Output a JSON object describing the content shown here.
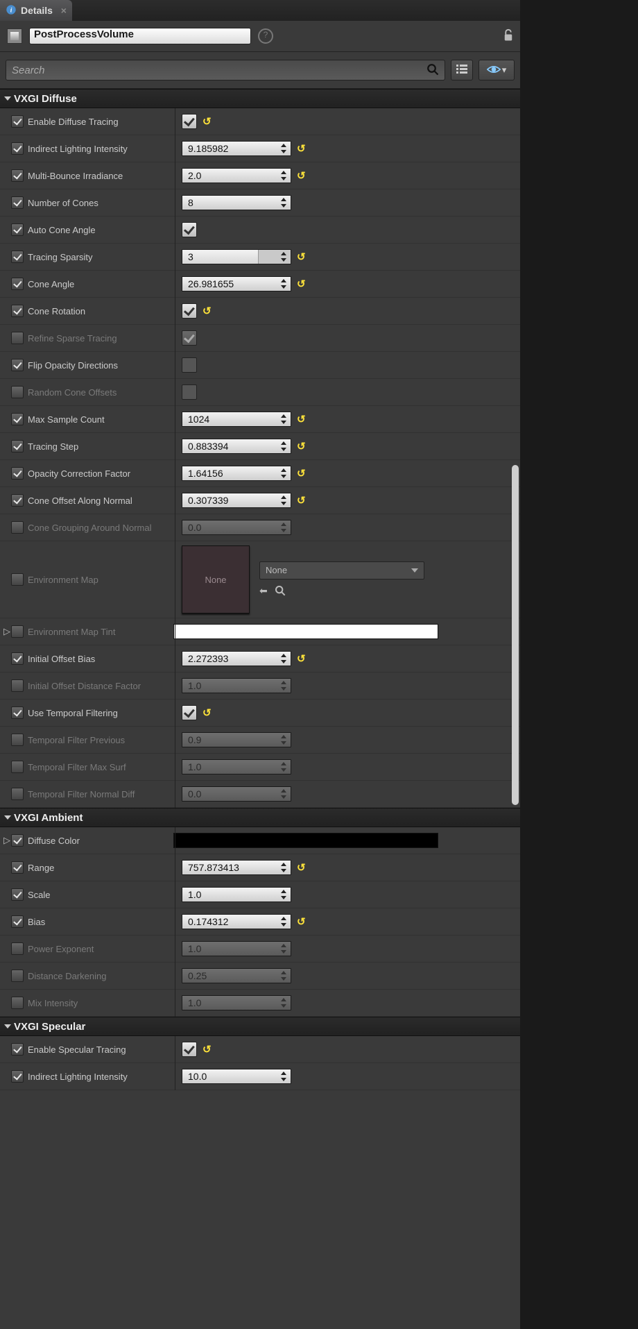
{
  "tab": {
    "title": "Details"
  },
  "header": {
    "component_name": "PostProcessVolume"
  },
  "search": {
    "placeholder": "Search"
  },
  "sections": {
    "diffuse": {
      "title": "VXGI Diffuse"
    },
    "ambient": {
      "title": "VXGI Ambient"
    },
    "specular": {
      "title": "VXGI Specular"
    }
  },
  "diffuse": {
    "enable_diffuse_tracing": {
      "label": "Enable Diffuse Tracing"
    },
    "indirect_lighting_intensity": {
      "label": "Indirect Lighting Intensity",
      "value": "9.185982"
    },
    "multi_bounce_irradiance": {
      "label": "Multi-Bounce Irradiance",
      "value": "2.0"
    },
    "number_of_cones": {
      "label": "Number of Cones",
      "value": "8"
    },
    "auto_cone_angle": {
      "label": "Auto Cone Angle"
    },
    "tracing_sparsity": {
      "label": "Tracing Sparsity",
      "value": "3"
    },
    "cone_angle": {
      "label": "Cone Angle",
      "value": "26.981655"
    },
    "cone_rotation": {
      "label": "Cone Rotation"
    },
    "refine_sparse_tracing": {
      "label": "Refine Sparse Tracing"
    },
    "flip_opacity_directions": {
      "label": "Flip Opacity Directions"
    },
    "random_cone_offsets": {
      "label": "Random Cone Offsets"
    },
    "max_sample_count": {
      "label": "Max Sample Count",
      "value": "1024"
    },
    "tracing_step": {
      "label": "Tracing Step",
      "value": "0.883394"
    },
    "opacity_correction_factor": {
      "label": "Opacity Correction Factor",
      "value": "1.64156"
    },
    "cone_offset_along_normal": {
      "label": "Cone Offset Along Normal",
      "value": "0.307339"
    },
    "cone_grouping_around_normal": {
      "label": "Cone Grouping Around Normal",
      "value": "0.0"
    },
    "environment_map": {
      "label": "Environment Map",
      "thumb": "None",
      "selection": "None"
    },
    "environment_map_tint": {
      "label": "Environment Map Tint"
    },
    "initial_offset_bias": {
      "label": "Initial Offset Bias",
      "value": "2.272393"
    },
    "initial_offset_distance_factor": {
      "label": "Initial Offset Distance Factor",
      "value": "1.0"
    },
    "use_temporal_filtering": {
      "label": "Use Temporal Filtering"
    },
    "temporal_filter_previous": {
      "label": "Temporal Filter Previous",
      "value": "0.9"
    },
    "temporal_filter_max_surf": {
      "label": "Temporal Filter Max Surf",
      "value": "1.0"
    },
    "temporal_filter_normal_diff": {
      "label": "Temporal Filter Normal Diff",
      "value": "0.0"
    }
  },
  "ambient": {
    "diffuse_color": {
      "label": "Diffuse Color"
    },
    "range": {
      "label": "Range",
      "value": "757.873413"
    },
    "scale": {
      "label": "Scale",
      "value": "1.0"
    },
    "bias": {
      "label": "Bias",
      "value": "0.174312"
    },
    "power_exponent": {
      "label": "Power Exponent",
      "value": "1.0"
    },
    "distance_darkening": {
      "label": "Distance Darkening",
      "value": "0.25"
    },
    "mix_intensity": {
      "label": "Mix Intensity",
      "value": "1.0"
    }
  },
  "specular": {
    "enable_specular_tracing": {
      "label": "Enable Specular Tracing"
    },
    "indirect_lighting_intensity": {
      "label": "Indirect Lighting Intensity",
      "value": "10.0"
    }
  }
}
